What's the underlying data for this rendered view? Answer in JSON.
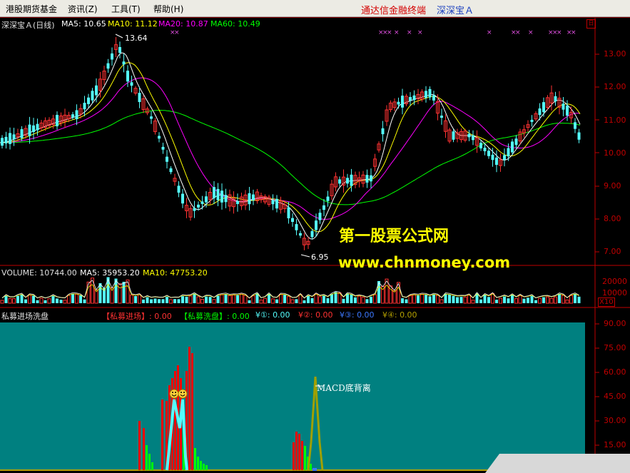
{
  "menubar": {
    "items": [
      "港股期货基金",
      "资讯(Z)",
      "工具(T)",
      "帮助(H)"
    ],
    "brand": "通达信金融终端",
    "stock": "深深宝Ａ"
  },
  "main": {
    "title": "深深宝Ａ(日线)",
    "ma5": "MA5: 10.65",
    "ma10": "MA10: 11.12",
    "ma20": "MA20: 10.87",
    "ma60": "MA60: 10.49",
    "high_label": "13.64",
    "low_label": "6.95",
    "price_ticks": [
      "13.00",
      "12.00",
      "11.00",
      "10.00",
      "9.00",
      "8.00",
      "7.00"
    ]
  },
  "volume": {
    "title": "VOLUME: 10744.00",
    "ma5": "MA5: 35953.20",
    "ma10": "MA10: 47753.20",
    "ticks": [
      "20000",
      "10000"
    ],
    "unit": "X10"
  },
  "indicator": {
    "name": "私募进场洗盘",
    "entry": "【私募进场】: 0.00",
    "wash": "【私募洗盘】: 0.00",
    "y1": "¥①: 0.00",
    "y2": "¥②: 0.00",
    "y3": "¥③: 0.00",
    "y4": "¥④: 0.00",
    "ticks": [
      "90.00",
      "75.00",
      "60.00",
      "45.00",
      "30.00",
      "15.00"
    ],
    "annotation": "MACD底背离"
  },
  "watermark": {
    "line1": "第一股票公式网",
    "line2": "www.chnmoney.com"
  },
  "colors": {
    "bg": "#000000",
    "up": "#ff3232",
    "down": "#54fcfc",
    "ma5": "#ffffff",
    "ma10": "#ffff00",
    "ma20": "#ff00ff",
    "ma60": "#00ff00",
    "axis": "#c00000",
    "indicator_bg": "#008080",
    "watermark": "#ffff00"
  }
}
